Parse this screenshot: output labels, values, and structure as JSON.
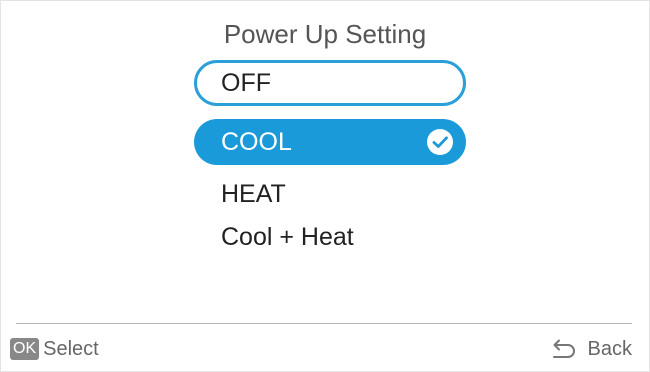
{
  "title": "Power Up Setting",
  "options": [
    {
      "label": "OFF",
      "state": "focused"
    },
    {
      "label": "COOL",
      "state": "selected"
    },
    {
      "label": "HEAT",
      "state": "normal"
    },
    {
      "label": "Cool + Heat",
      "state": "normal"
    }
  ],
  "footer": {
    "ok_key": "OK",
    "select_label": "Select",
    "back_label": "Back",
    "back_icon": "back-arrow-icon"
  },
  "colors": {
    "accent": "#1b9ad9",
    "focus_border": "#2a9fd8",
    "text": "#222222",
    "muted_text": "#666666",
    "key_background": "#888888"
  }
}
